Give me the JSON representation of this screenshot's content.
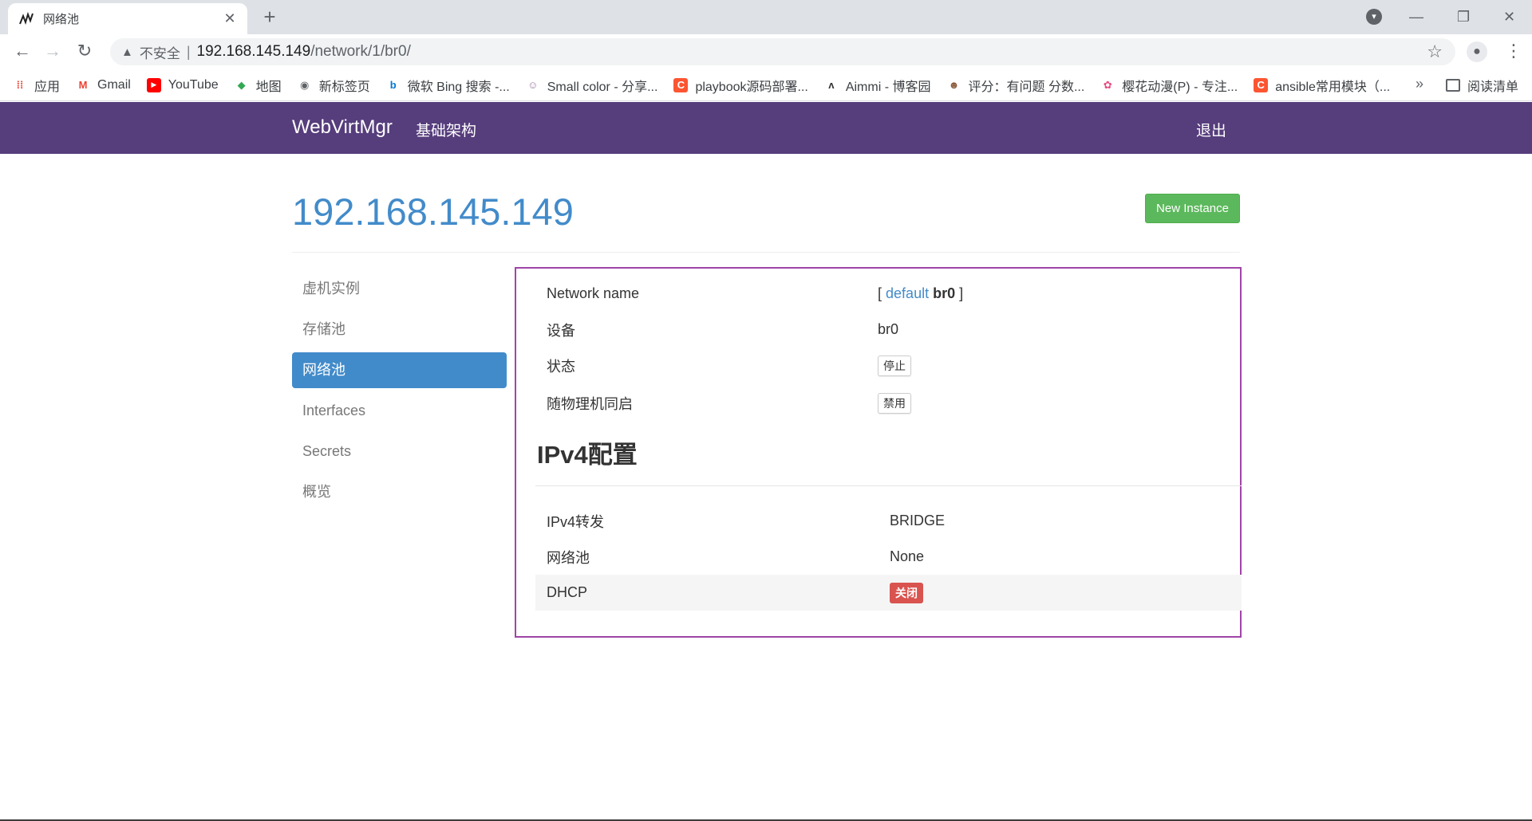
{
  "browser": {
    "tab_title": "网络池",
    "url_insecure_label": "不安全",
    "url_host": "192.168.145.149",
    "url_path": "/network/1/br0/",
    "bookmarks": [
      {
        "label": "应用",
        "icon": "apps-grid-icon",
        "color": "#ea4335"
      },
      {
        "label": "Gmail",
        "icon": "gmail-icon",
        "color": "#ea4335"
      },
      {
        "label": "YouTube",
        "icon": "youtube-icon",
        "color": "#ff0000"
      },
      {
        "label": "地图",
        "icon": "maps-icon",
        "color": "#34a853"
      },
      {
        "label": "新标签页",
        "icon": "globe-icon",
        "color": "#5f6368"
      },
      {
        "label": "微软 Bing 搜索 -...",
        "icon": "bing-icon",
        "color": "#0078d4"
      },
      {
        "label": "Small color - 分享...",
        "icon": "avatar-icon",
        "color": "#a07aa8"
      },
      {
        "label": "playbook源码部署...",
        "icon": "csdn-icon",
        "color": "#fc5531"
      },
      {
        "label": "Aimmi - 博客园",
        "icon": "blog-icon",
        "color": "#333333"
      },
      {
        "label": "评分：有问题 分数...",
        "icon": "anime-icon",
        "color": "#8b5a3c"
      },
      {
        "label": "樱花动漫(P) - 专注...",
        "icon": "sakura-icon",
        "color": "#e84a7f"
      },
      {
        "label": "ansible常用模块（...",
        "icon": "csdn-icon",
        "color": "#fc5531"
      }
    ],
    "bookmarks_more": "»",
    "reading_list": "阅读清单"
  },
  "appnav": {
    "brand": "WebVirtMgr",
    "infra_link": "基础架构",
    "logout": "退出"
  },
  "page": {
    "title": "192.168.145.149",
    "new_instance": "New Instance"
  },
  "sidebar": {
    "items": [
      {
        "label": "虚机实例",
        "active": false
      },
      {
        "label": "存储池",
        "active": false
      },
      {
        "label": "网络池",
        "active": true
      },
      {
        "label": "Interfaces",
        "active": false
      },
      {
        "label": "Secrets",
        "active": false
      },
      {
        "label": "概览",
        "active": false
      }
    ]
  },
  "network": {
    "name_label": "Network name",
    "name_bracket_open": "[",
    "name_default_link": "default",
    "name_current": "br0",
    "name_bracket_close": "]",
    "device_label": "设备",
    "device_value": "br0",
    "state_label": "状态",
    "state_button": "停止",
    "autostart_label": "随物理机同启",
    "autostart_button": "禁用",
    "ipv4_heading": "IPv4配置",
    "forward_label": "IPv4转发",
    "forward_value": "BRIDGE",
    "pool_label": "网络池",
    "pool_value": "None",
    "dhcp_label": "DHCP",
    "dhcp_value": "关闭"
  },
  "colors": {
    "navbar": "#563d7c",
    "link": "#428bca",
    "success": "#5cb85c",
    "danger": "#d9534f",
    "panel_border": "#a044a8"
  }
}
